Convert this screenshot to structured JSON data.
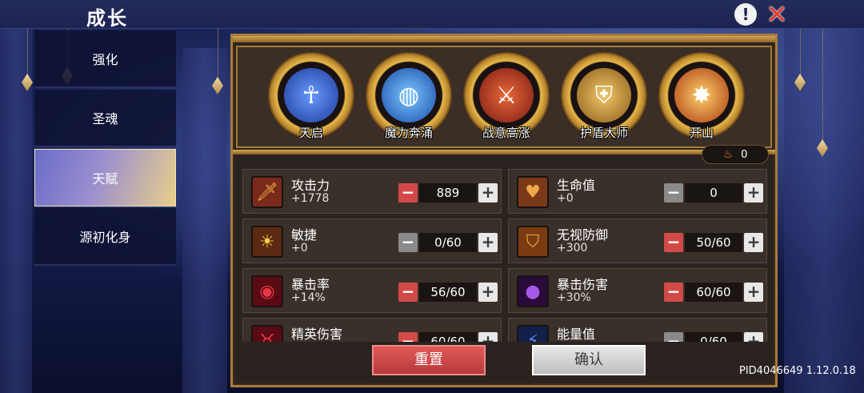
{
  "header": {
    "title": "成长",
    "help_icon": "help-icon",
    "close_icon": "close-icon"
  },
  "sidebar": {
    "items": [
      {
        "label": "强化",
        "active": false
      },
      {
        "label": "圣魂",
        "active": false
      },
      {
        "label": "天赋",
        "active": true
      },
      {
        "label": "源初化身",
        "active": false
      }
    ]
  },
  "talents": [
    {
      "name": "天启",
      "icon": "human-figure-icon",
      "color": "#3a6ad8"
    },
    {
      "name": "魔力奔涌",
      "icon": "swirl-icon",
      "color": "#2a7ad8"
    },
    {
      "name": "战意高涨",
      "icon": "warrior-icon",
      "color": "#b83a28"
    },
    {
      "name": "护盾大师",
      "icon": "shield-icon",
      "color": "#c89838"
    },
    {
      "name": "开山",
      "icon": "burst-icon",
      "color": "#e86a28"
    }
  ],
  "points": {
    "value": "0",
    "icon": "flame-icon"
  },
  "stats": [
    {
      "name": "攻击力",
      "bonus": "+1778",
      "value": "889",
      "minus_enabled": true,
      "icon": "sword-icon",
      "icon_color": "#e8a838"
    },
    {
      "name": "生命值",
      "bonus": "+0",
      "value": "0",
      "minus_enabled": false,
      "icon": "heart-icon",
      "icon_color": "#e88a38"
    },
    {
      "name": "敏捷",
      "bonus": "+0",
      "value": "0/60",
      "minus_enabled": false,
      "icon": "sun-icon",
      "icon_color": "#f0b838"
    },
    {
      "name": "无视防御",
      "bonus": "+300",
      "value": "50/60",
      "minus_enabled": true,
      "icon": "broken-shield-icon",
      "icon_color": "#e89838"
    },
    {
      "name": "暴击率",
      "bonus": "+14%",
      "value": "56/60",
      "minus_enabled": true,
      "icon": "vortex-icon",
      "icon_color": "#c82838"
    },
    {
      "name": "暴击伤害",
      "bonus": "+30%",
      "value": "60/60",
      "minus_enabled": true,
      "icon": "dark-orb-icon",
      "icon_color": "#7a38c8"
    },
    {
      "name": "精英伤害",
      "bonus": "",
      "value": "60/60",
      "minus_enabled": true,
      "icon": "horn-icon",
      "icon_color": "#c82838"
    },
    {
      "name": "能量值",
      "bonus": "",
      "value": "0/60",
      "minus_enabled": false,
      "icon": "energy-icon",
      "icon_color": "#3a6ad8"
    }
  ],
  "buttons": {
    "reset": "重置",
    "confirm": "确认"
  },
  "version": "PID4046649 1.12.0.18"
}
